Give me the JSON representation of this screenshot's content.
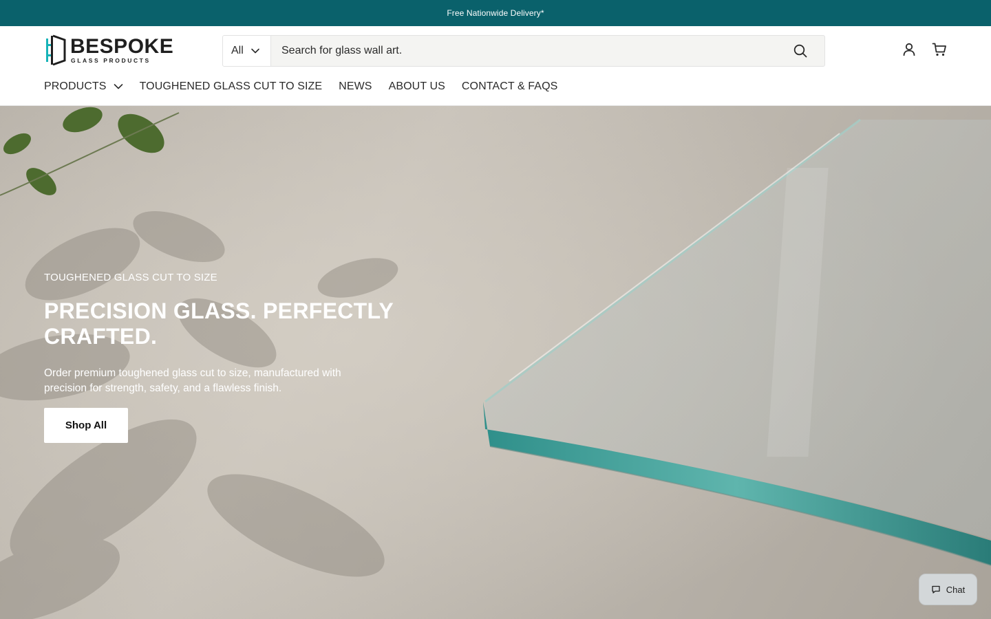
{
  "announcement": {
    "text": "Free Nationwide Delivery*"
  },
  "brand": {
    "name": "BESPOKE",
    "tagline": "GLASS PRODUCTS",
    "accent": "#0a616b"
  },
  "search": {
    "category": "All",
    "placeholder": "Search for glass wall art.",
    "value": ""
  },
  "header_icons": [
    "account-icon",
    "cart-icon"
  ],
  "nav": {
    "items": [
      {
        "label": "PRODUCTS",
        "has_dropdown": true
      },
      {
        "label": "TOUGHENED GLASS CUT TO SIZE",
        "has_dropdown": false
      },
      {
        "label": "NEWS",
        "has_dropdown": false
      },
      {
        "label": "ABOUT US",
        "has_dropdown": false
      },
      {
        "label": "CONTACT & FAQS",
        "has_dropdown": false
      }
    ]
  },
  "hero": {
    "eyebrow": "TOUGHENED GLASS CUT TO SIZE",
    "title": "PRECISION GLASS. PERFECTLY CRAFTED.",
    "description": "Order premium toughened glass cut to size, manufactured with precision for strength, safety, and a flawless finish.",
    "button": "Shop All"
  },
  "chat": {
    "label": "Chat"
  }
}
